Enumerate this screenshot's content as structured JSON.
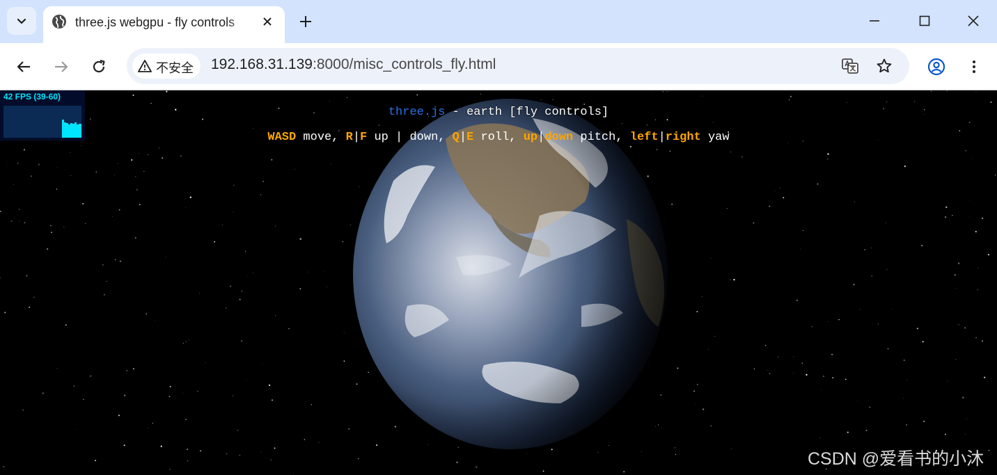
{
  "tab": {
    "title": "three.js webgpu - fly controls"
  },
  "omnibox": {
    "security_label": "不安全",
    "url_host": "192.168.31.139",
    "url_rest": ":8000/misc_controls_fly.html"
  },
  "stats": {
    "fps_text": "42 FPS (39-60)"
  },
  "info": {
    "link_text": "three.js",
    "separator": " - ",
    "title_text": "earth [fly controls]"
  },
  "controls_help": [
    {
      "text": "WASD",
      "key": true
    },
    {
      "text": " move, ",
      "key": false
    },
    {
      "text": "R",
      "key": true
    },
    {
      "text": "|",
      "key": false
    },
    {
      "text": "F",
      "key": true
    },
    {
      "text": " up | down, ",
      "key": false
    },
    {
      "text": "Q",
      "key": true
    },
    {
      "text": "|",
      "key": false
    },
    {
      "text": "E",
      "key": true
    },
    {
      "text": " roll, ",
      "key": false
    },
    {
      "text": "up",
      "key": true
    },
    {
      "text": "|",
      "key": false
    },
    {
      "text": "down",
      "key": true
    },
    {
      "text": " pitch, ",
      "key": false
    },
    {
      "text": "left",
      "key": true
    },
    {
      "text": "|",
      "key": false
    },
    {
      "text": "right",
      "key": true
    },
    {
      "text": " yaw",
      "key": false
    }
  ],
  "watermark": "CSDN @爱看书的小沐",
  "colors": {
    "accent_key": "#ffa500",
    "link": "#2b71e6",
    "stats_text": "#00e5ff"
  }
}
